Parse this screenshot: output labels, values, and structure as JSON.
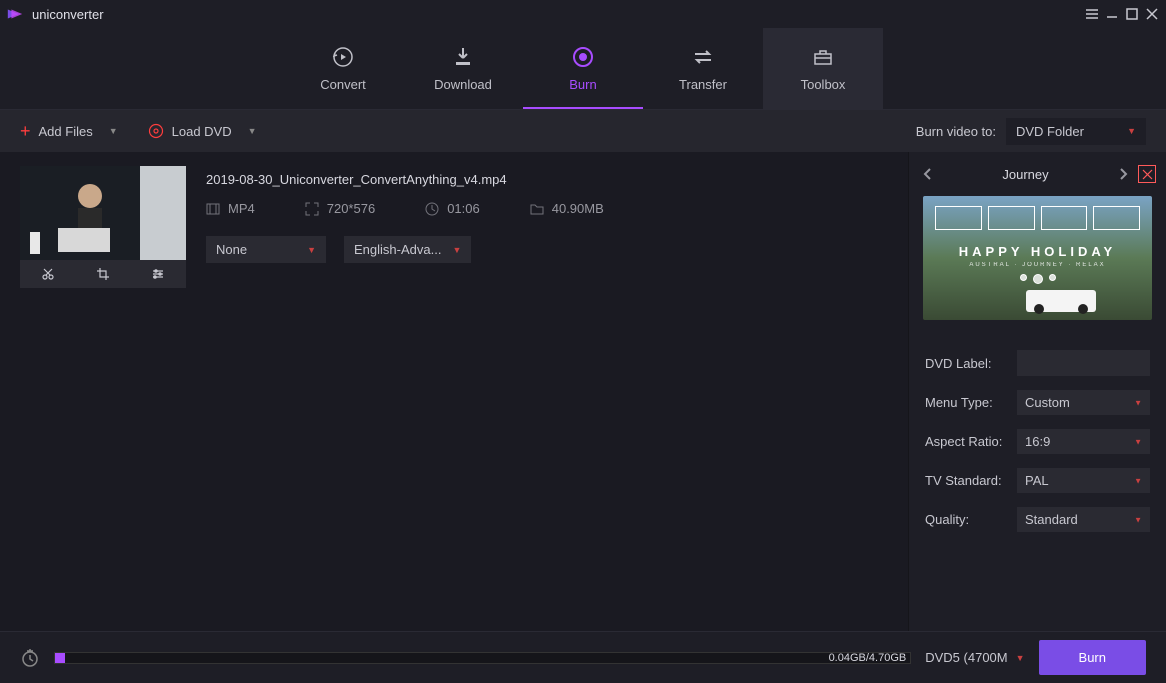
{
  "app": {
    "title": "uniconverter"
  },
  "nav": {
    "convert": "Convert",
    "download": "Download",
    "burn": "Burn",
    "transfer": "Transfer",
    "toolbox": "Toolbox"
  },
  "toolbar": {
    "add_files": "Add Files",
    "load_dvd": "Load DVD",
    "burn_to_label": "Burn video to:",
    "burn_target": "DVD Folder"
  },
  "file": {
    "name": "2019-08-30_Uniconverter_ConvertAnything_v4.mp4",
    "format": "MP4",
    "resolution": "720*576",
    "duration": "01:06",
    "size": "40.90MB",
    "subtitle": "None",
    "audio": "English-Adva..."
  },
  "template": {
    "name": "Journey",
    "overlay_title": "HAPPY HOLIDAY",
    "overlay_sub": "AUSTRAL · JOURNEY · RELAX"
  },
  "settings": {
    "dvd_label_label": "DVD Label:",
    "dvd_label_value": "",
    "menu_type_label": "Menu Type:",
    "menu_type_value": "Custom",
    "aspect_label": "Aspect Ratio:",
    "aspect_value": "16:9",
    "tv_label": "TV Standard:",
    "tv_value": "PAL",
    "quality_label": "Quality:",
    "quality_value": "Standard"
  },
  "footer": {
    "progress_text": "0.04GB/4.70GB",
    "disc": "DVD5 (4700M",
    "burn": "Burn"
  }
}
